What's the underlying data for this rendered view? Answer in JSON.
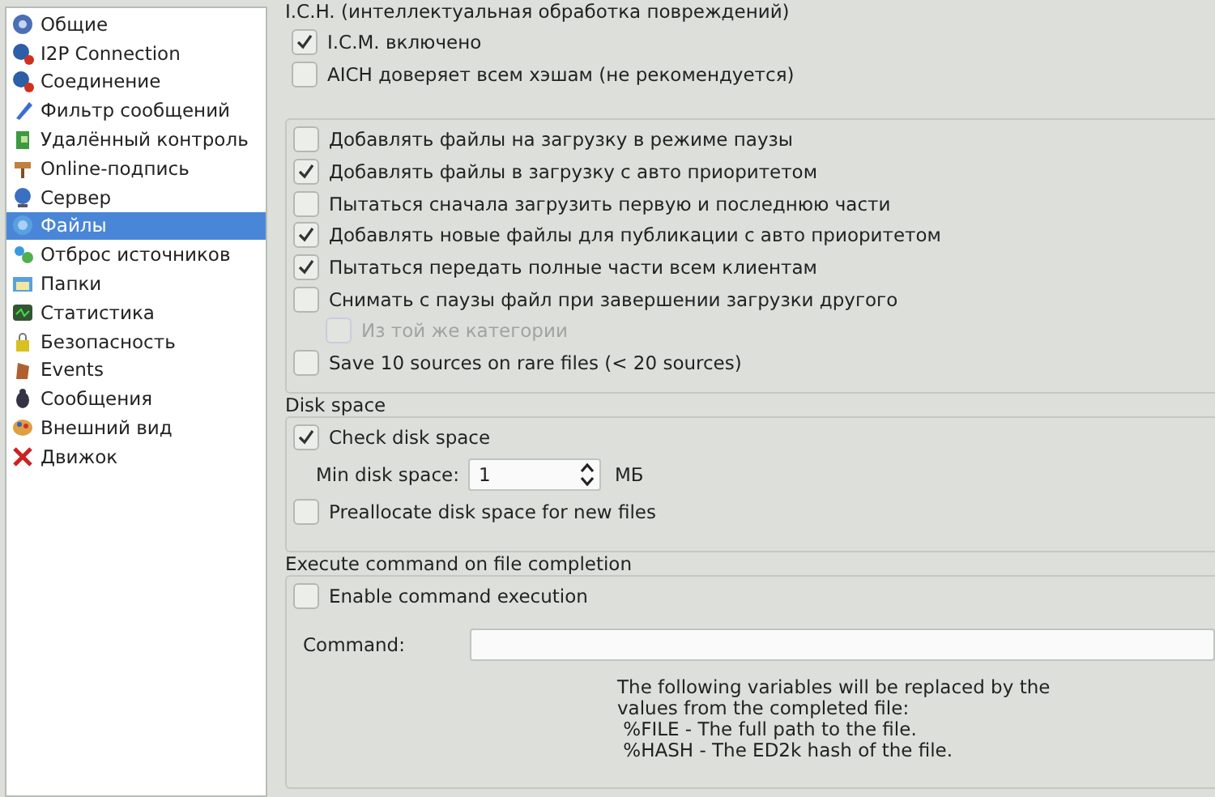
{
  "sidebar": {
    "items": [
      {
        "label": "Общие",
        "selected": false
      },
      {
        "label": "I2P Connection",
        "selected": false
      },
      {
        "label": "Соединение",
        "selected": false
      },
      {
        "label": "Фильтр сообщений",
        "selected": false
      },
      {
        "label": "Удалённый контроль",
        "selected": false
      },
      {
        "label": "Online-подпись",
        "selected": false
      },
      {
        "label": "Сервер",
        "selected": false
      },
      {
        "label": "Файлы",
        "selected": true
      },
      {
        "label": "Отброс источников",
        "selected": false
      },
      {
        "label": "Папки",
        "selected": false
      },
      {
        "label": "Статистика",
        "selected": false
      },
      {
        "label": "Безопасность",
        "selected": false
      },
      {
        "label": "Events",
        "selected": false
      },
      {
        "label": "Сообщения",
        "selected": false
      },
      {
        "label": "Внешний вид",
        "selected": false
      },
      {
        "label": "Движок",
        "selected": false
      }
    ]
  },
  "ich": {
    "title": "I.C.H. (интеллектуальная обработка повреждений)",
    "options": [
      {
        "label": "I.C.M. включено",
        "checked": true,
        "disabled": false
      },
      {
        "label": "AICH доверяет всем хэшам (не рекомендуется)",
        "checked": false,
        "disabled": false
      }
    ]
  },
  "files": {
    "options": [
      {
        "label": "Добавлять файлы на загрузку в режиме паузы",
        "checked": false,
        "disabled": false
      },
      {
        "label": "Добавлять файлы в загрузку с авто приоритетом",
        "checked": true,
        "disabled": false
      },
      {
        "label": "Пытаться сначала загрузить первую и последнюю части",
        "checked": false,
        "disabled": false
      },
      {
        "label": "Добавлять новые файлы для публикации с авто приоритетом",
        "checked": true,
        "disabled": false
      },
      {
        "label": "Пытаться передать полные части всем клиентам",
        "checked": true,
        "disabled": false
      },
      {
        "label": "Снимать с паузы файл при завершении загрузки другого",
        "checked": false,
        "disabled": false,
        "children": [
          {
            "label": "Из той же категории",
            "checked": false,
            "disabled": true
          }
        ]
      },
      {
        "label": "Save 10 sources on rare files (< 20 sources)",
        "checked": false,
        "disabled": false
      }
    ]
  },
  "disk_space": {
    "title": "Disk space",
    "check": {
      "label": "Check disk space",
      "checked": true,
      "disabled": false
    },
    "min": {
      "label": "Min disk space:",
      "value": "1",
      "unit": "МБ"
    },
    "preallocate": {
      "label": "Preallocate disk space for new files",
      "checked": false,
      "disabled": false
    }
  },
  "execute": {
    "title": "Execute command on file completion",
    "enable": {
      "label": "Enable command execution",
      "checked": false,
      "disabled": false
    },
    "command": {
      "label": "Command:"
    },
    "notes": [
      "The following variables will be replaced by the",
      "values from the completed file:",
      " %FILE - The full path to the file.",
      " %HASH - The ED2k hash of the file."
    ]
  }
}
